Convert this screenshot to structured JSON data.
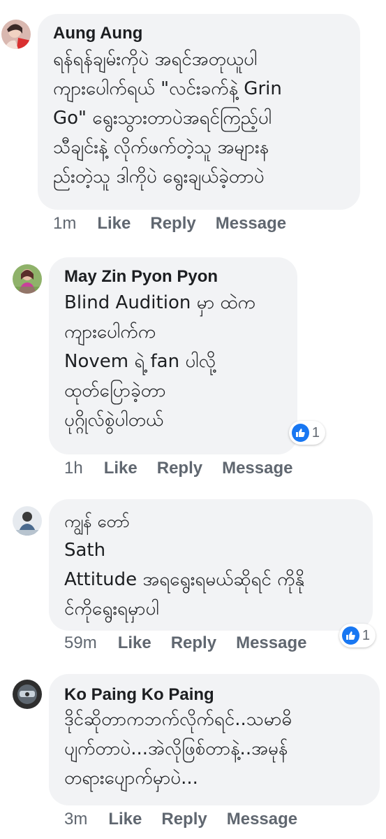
{
  "comments": [
    {
      "author": "Aung Aung",
      "lines": [
        "ရန်ရန်ချမ်းကိုပဲ အရင်အတုယူပါ",
        "ကျားပေါက်ရယ် \"လင်းခက်နဲ့ Grin",
        "Go\" ရွေးသွားတာပဲအရင်ကြည့်ပါ",
        "သီချင်းနဲ့ လိုက်ဖက်တဲ့သူ အများန",
        "ည်းတဲ့သူ ဒါကိုပဲ ရွေးချယ်ခဲ့တာပဲ"
      ],
      "time": "1m",
      "like": "Like",
      "reply": "Reply",
      "message": "Message",
      "reaction_count": ""
    },
    {
      "author": "May Zin Pyon Pyon",
      "lines": [
        "Blind Audition မှာ ထဲက",
        "ကျားပေါက်က",
        "Novem ရဲ့ fan ပါလို့",
        "ထုတ်ပြောခဲ့တာ",
        "ပုဂ္ဂိုလ်စွဲပါတယ်"
      ],
      "time": "1h",
      "like": "Like",
      "reply": "Reply",
      "message": "Message",
      "reaction_count": "1"
    },
    {
      "author": "ကျွန် တော်",
      "lines": [
        "Sath",
        "Attitude အရရွေးရမယ်ဆိုရင် ကိုနို",
        "င်ကိုရွေးရမှာပါ"
      ],
      "time": "59m",
      "like": "Like",
      "reply": "Reply",
      "message": "Message",
      "reaction_count": "1"
    },
    {
      "author": "Ko Paing Ko Paing",
      "lines": [
        "ဒိုင်ဆိုတာကဘက်လိုက်ရင်..သမာဓိ",
        "ပျက်တာပဲ...အဲလိုဖြစ်တာနဲ့..အမုန်",
        "တရားပျောက်မှာပဲ..."
      ],
      "time": "3m",
      "like": "Like",
      "reply": "Reply",
      "message": "Message",
      "reaction_count": ""
    }
  ],
  "colors": {
    "bubble": "#f2f3f5",
    "meta": "#606770",
    "like_blue": "#1877f2"
  }
}
